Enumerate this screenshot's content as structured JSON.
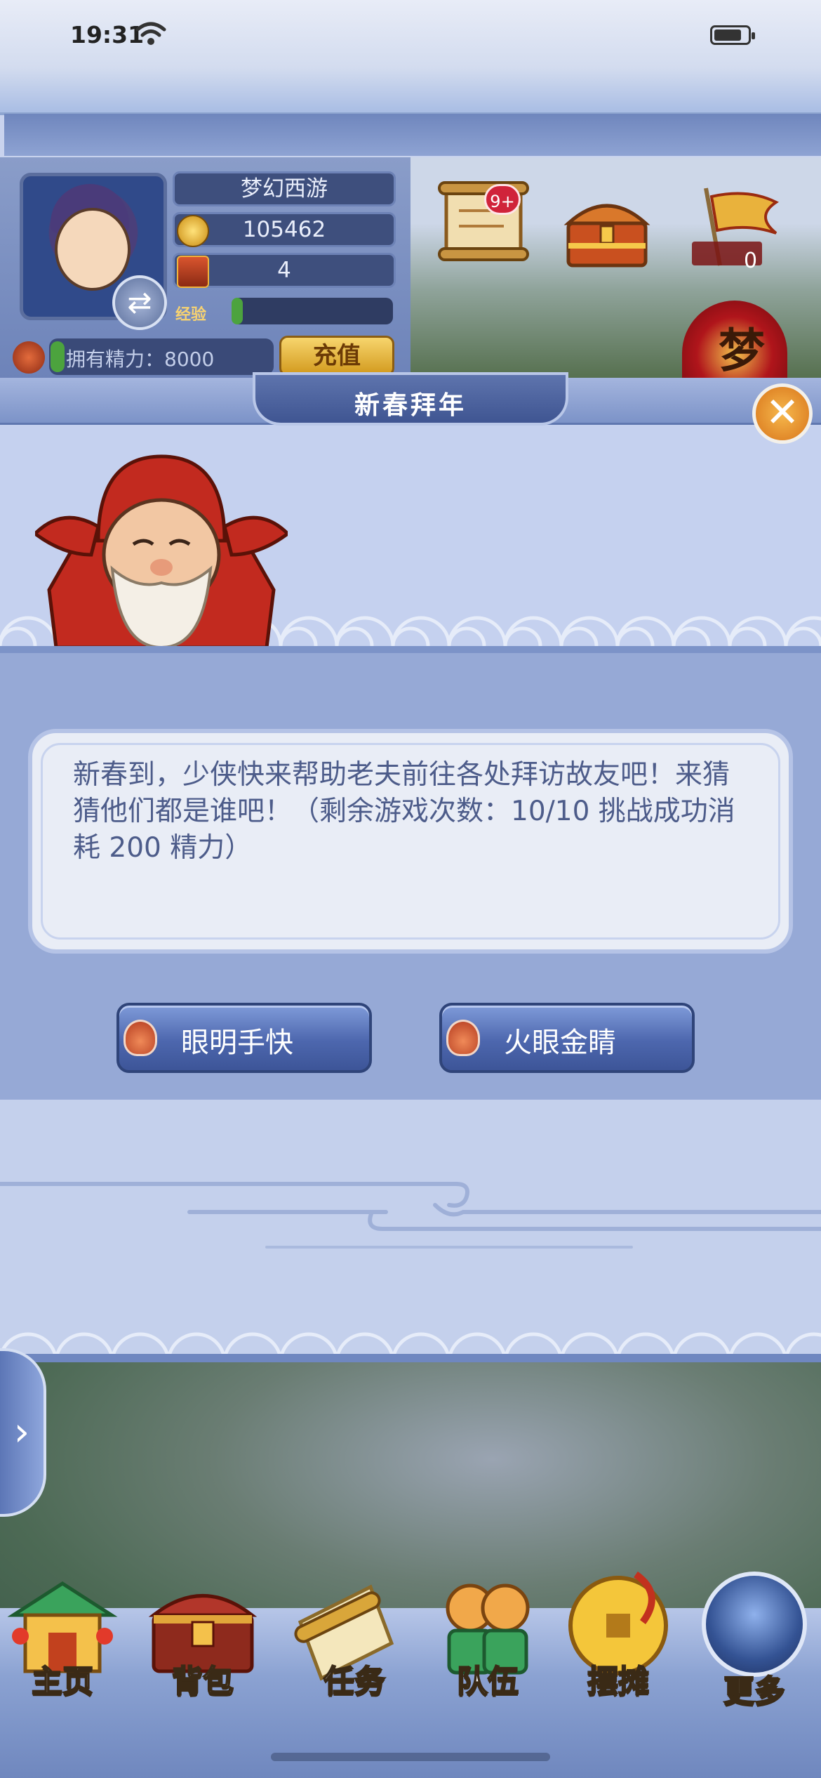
{
  "status_bar": {
    "time": "19:31"
  },
  "player": {
    "game_name": "梦幻西游",
    "gold": "105462",
    "chests": "4",
    "exp_label": "经验",
    "energy_label": "拥有精力：8000",
    "recharge_label": "充值"
  },
  "top_icons": {
    "scroll_badge": "9+",
    "flag_count": "0",
    "dream_char": "梦"
  },
  "dialog": {
    "title": "新春拜年",
    "message": "新春到，少侠快来帮助老夫前往各处拜访故友吧！来猜猜他们都是谁吧！（剩余游戏次数：10/10 挑战成功消耗 200 精力）",
    "buttons": [
      {
        "label": "眼明手快"
      },
      {
        "label": "火眼金睛"
      }
    ]
  },
  "nav": {
    "items": [
      {
        "label": "主页"
      },
      {
        "label": "背包"
      },
      {
        "label": "任务"
      },
      {
        "label": "队伍"
      },
      {
        "label": "摆摊"
      },
      {
        "label": "更多"
      }
    ]
  }
}
